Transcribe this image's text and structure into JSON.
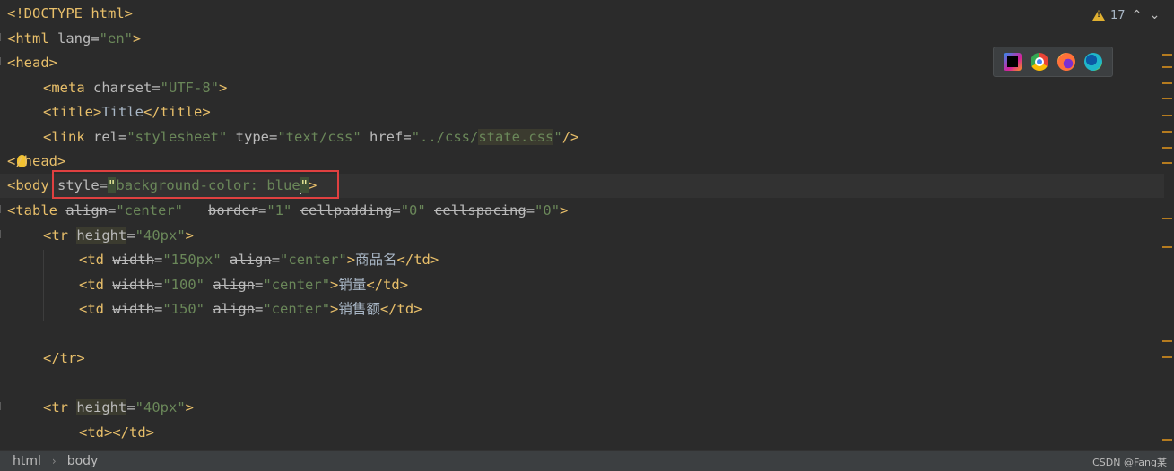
{
  "inspection": {
    "count": "17"
  },
  "browsers": [
    "intellij-icon",
    "chrome-icon",
    "firefox-icon",
    "edge-icon"
  ],
  "breadcrumb": {
    "items": [
      "html",
      "body"
    ]
  },
  "watermark": "CSDN @Fang某",
  "code": {
    "l1": "<!DOCTYPE html>",
    "l2_open": "<html ",
    "l2_attr": "lang",
    "l2_eq": "=",
    "l2_val": "\"en\"",
    "l2_close": ">",
    "l3": "<head>",
    "l4_open": "<meta ",
    "l4_attr": "charset",
    "l4_eq": "=",
    "l4_val": "\"UTF-8\"",
    "l4_close": ">",
    "l5_open": "<title>",
    "l5_text": "Title",
    "l5_close": "</title>",
    "l6_open": "<link ",
    "l6_a1": "rel",
    "l6_v1": "\"stylesheet\"",
    "l6_a2": "type",
    "l6_v2": "\"text/css\"",
    "l6_a3": "href",
    "l6_v3a": "\"../css/",
    "l6_v3b": "state.css",
    "l6_v3c": "\"",
    "l6_close": "/>",
    "l7": "</head>",
    "l8_open": "<body ",
    "l8_attr": "style",
    "l8_eq": "=",
    "l8_q1": "\"",
    "l8_val": "background-color: blue",
    "l8_q2": "\"",
    "l8_close": ">",
    "l9_open": "<table ",
    "l9_a1": "align",
    "l9_v1": "\"center\"",
    "l9_a2": "border",
    "l9_v2": "\"1\"",
    "l9_a3": "cellpadding",
    "l9_v3": "\"0\"",
    "l9_a4": "cellspacing",
    "l9_v4": "\"0\"",
    "l9_close": ">",
    "l10_open": "<tr ",
    "l10_attr": "height",
    "l10_val": "\"40px\"",
    "l10_close": ">",
    "l11_open": "<td ",
    "l11_a1": "width",
    "l11_v1": "\"150px\"",
    "l11_a2": "align",
    "l11_v2": "\"center\"",
    "l11_text": "商品名",
    "l11_close": "</td>",
    "l12_open": "<td ",
    "l12_a1": "width",
    "l12_v1": "\"100\"",
    "l12_a2": "align",
    "l12_v2": "\"center\"",
    "l12_text": "销量",
    "l12_close": "</td>",
    "l13_open": "<td ",
    "l13_a1": "width",
    "l13_v1": "\"150\"",
    "l13_a2": "align",
    "l13_v2": "\"center\"",
    "l13_text": "销售额",
    "l13_close": "</td>",
    "l15": "</tr>",
    "l17_open": "<tr ",
    "l17_attr": "height",
    "l17_val": "\"40px\"",
    "l17_close": ">",
    "l18": "<td></td>",
    "eq": "=",
    "gt": ">"
  }
}
